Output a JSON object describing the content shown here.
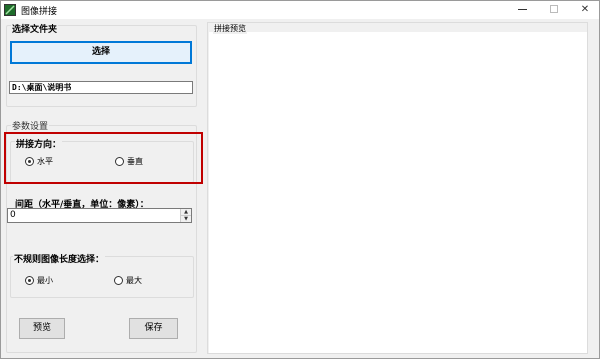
{
  "window": {
    "title": "图像拼接"
  },
  "folder": {
    "section_label": "选择文件夹",
    "select_button": "选择",
    "path_value": "D:\\桌面\\说明书"
  },
  "params": {
    "group_label": "参数设置",
    "direction": {
      "label": "拼接方向：",
      "options": [
        {
          "label": "水平",
          "checked": true
        },
        {
          "label": "垂直",
          "checked": false
        }
      ]
    },
    "spacing": {
      "label": "间距（水平/垂直，单位：像素）：",
      "value": "0"
    },
    "irregular": {
      "label": "不规则图像长度选择：",
      "options": [
        {
          "label": "最小",
          "checked": true
        },
        {
          "label": "最大",
          "checked": false
        }
      ]
    }
  },
  "actions": {
    "preview": "预览",
    "save": "保存"
  },
  "preview_panel": {
    "label": "拼接预览"
  }
}
